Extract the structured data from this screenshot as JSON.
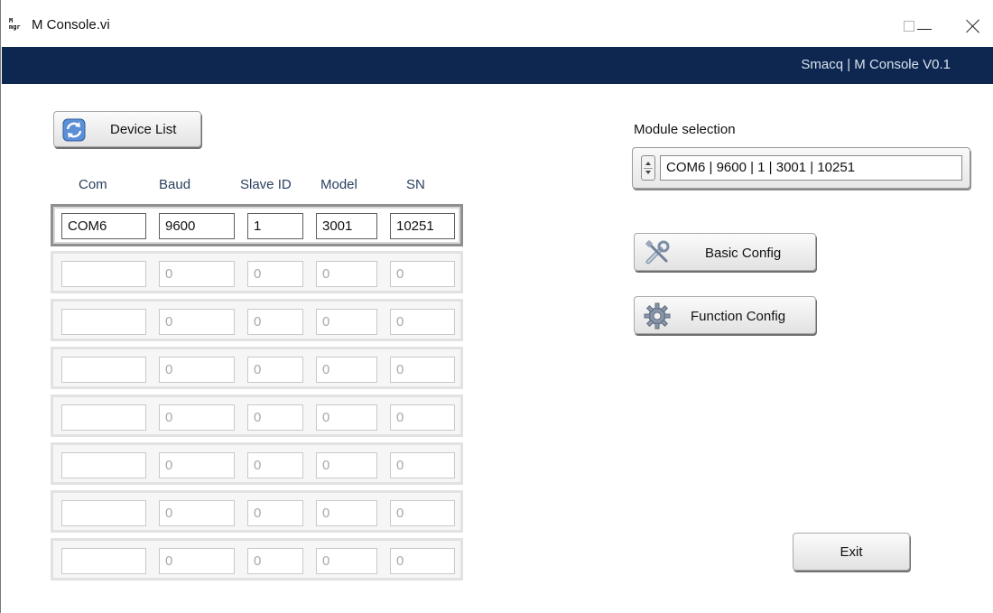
{
  "window": {
    "title": "M Console.vi",
    "icon_text": [
      "M",
      "mgr"
    ]
  },
  "banner": {
    "text": "Smacq | M Console V0.1",
    "background": "#0d2750"
  },
  "buttons": {
    "device_list": "Device List",
    "basic_config": "Basic Config",
    "function_config": "Function Config",
    "exit": "Exit"
  },
  "table": {
    "columns": [
      "Com",
      "Baud",
      "Slave ID",
      "Model",
      "SN"
    ],
    "rows": [
      {
        "com": "COM6",
        "baud": "9600",
        "slave_id": "1",
        "model": "3001",
        "sn": "10251"
      },
      {
        "com": "",
        "baud": "0",
        "slave_id": "0",
        "model": "0",
        "sn": "0"
      },
      {
        "com": "",
        "baud": "0",
        "slave_id": "0",
        "model": "0",
        "sn": "0"
      },
      {
        "com": "",
        "baud": "0",
        "slave_id": "0",
        "model": "0",
        "sn": "0"
      },
      {
        "com": "",
        "baud": "0",
        "slave_id": "0",
        "model": "0",
        "sn": "0"
      },
      {
        "com": "",
        "baud": "0",
        "slave_id": "0",
        "model": "0",
        "sn": "0"
      },
      {
        "com": "",
        "baud": "0",
        "slave_id": "0",
        "model": "0",
        "sn": "0"
      },
      {
        "com": "",
        "baud": "0",
        "slave_id": "0",
        "model": "0",
        "sn": "0"
      }
    ]
  },
  "module_selection": {
    "label": "Module selection",
    "value": "COM6 | 9600 | 1 | 3001 | 10251"
  },
  "icons": {
    "device_list": "refresh-icon",
    "basic_config": "tools-icon",
    "function_config": "gear-icon",
    "window": "app-icon"
  }
}
